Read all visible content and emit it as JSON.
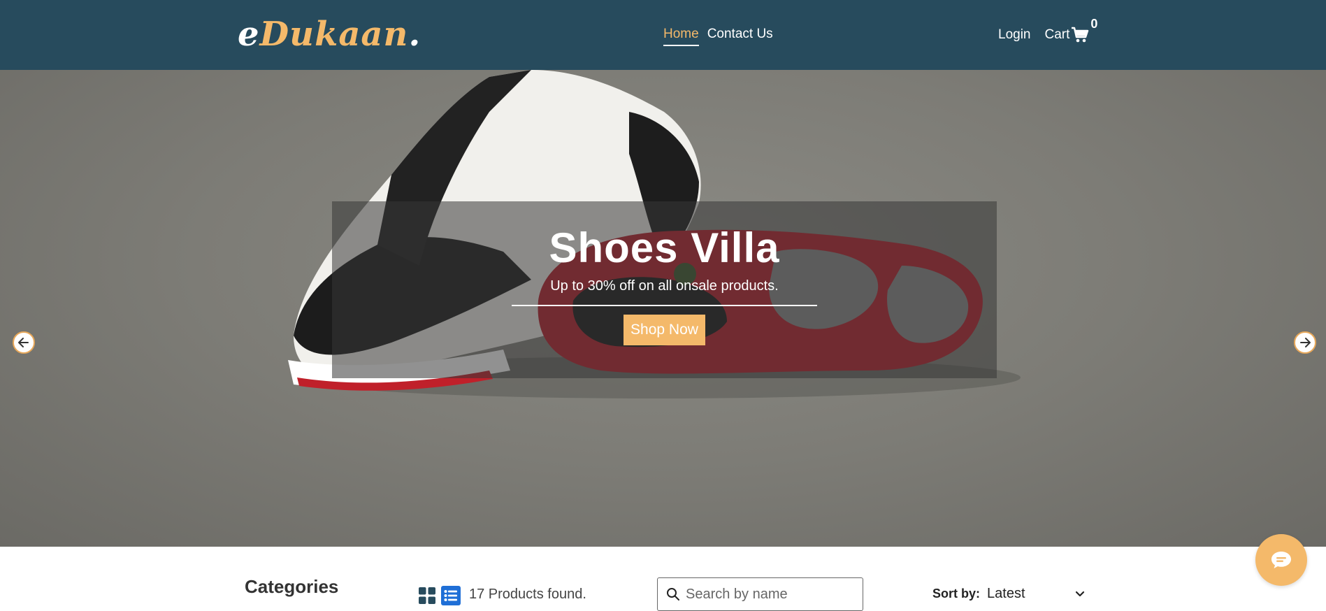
{
  "header": {
    "logo": {
      "first": "e",
      "rest": "Dukaan",
      "dot": "."
    },
    "nav": [
      {
        "label": "Home",
        "active": true
      },
      {
        "label": "Contact Us",
        "active": false
      }
    ],
    "login_label": "Login",
    "cart_label": "Cart",
    "cart_count": "0"
  },
  "hero": {
    "title": "Shoes Villa",
    "subtitle": "Up to 30% off on all onsale products.",
    "cta_label": "Shop Now"
  },
  "products": {
    "categories_title": "Categories",
    "found_text": "17 Products found.",
    "search_placeholder": "Search by name",
    "sort_label": "Sort by:",
    "sort_value": "Latest"
  },
  "colors": {
    "header_bg": "#274b5d",
    "accent": "#f4b96a",
    "list_view_active": "#1f6fd6"
  },
  "icons": [
    "cart-icon",
    "arrow-left-icon",
    "arrow-right-icon",
    "grid-view-icon",
    "list-view-icon",
    "search-icon",
    "chevron-down-icon",
    "chat-icon"
  ]
}
